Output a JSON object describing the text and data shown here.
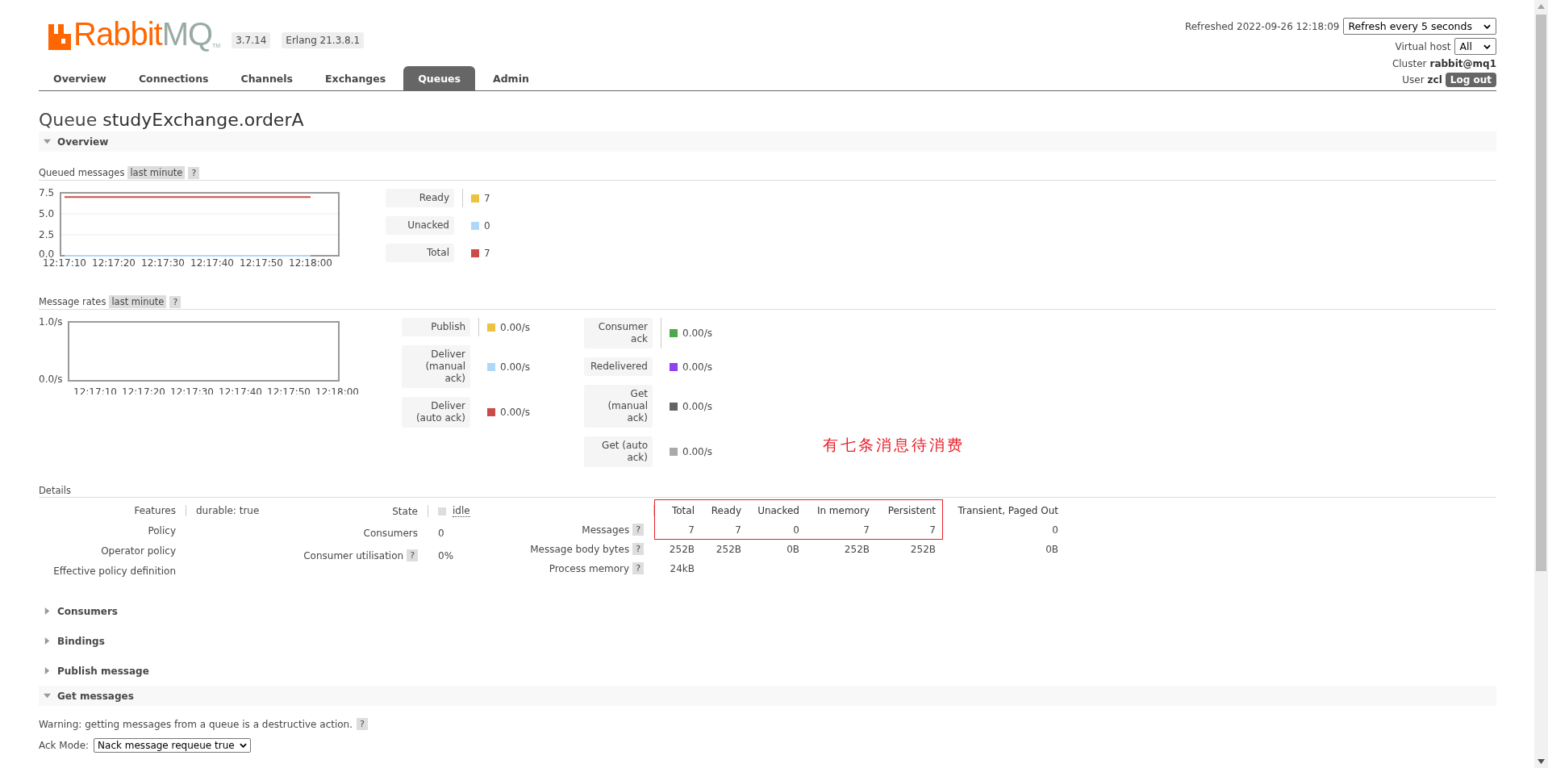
{
  "header": {
    "logo": {
      "word": "Rabbit",
      "suffix": "MQ",
      "mark": "TM"
    },
    "version": "3.7.14",
    "erlang": "Erlang 21.3.8.1",
    "refreshed": "Refreshed 2022-09-26 12:18:09",
    "refresh_select": "Refresh every 5 seconds",
    "vhost_label": "Virtual host",
    "vhost_select": "All",
    "cluster_label": "Cluster",
    "cluster": "rabbit@mq1",
    "user_label": "User",
    "user": "zcl",
    "logout": "Log out"
  },
  "tabs": [
    {
      "label": "Overview",
      "selected": false
    },
    {
      "label": "Connections",
      "selected": false
    },
    {
      "label": "Channels",
      "selected": false
    },
    {
      "label": "Exchanges",
      "selected": false
    },
    {
      "label": "Queues",
      "selected": true
    },
    {
      "label": "Admin",
      "selected": false
    }
  ],
  "title": {
    "prefix": "Queue",
    "name": "studyExchange.orderA"
  },
  "overview": {
    "heading": "Overview",
    "expanded": true,
    "queued": {
      "label": "Queued messages",
      "range": "last minute",
      "help": "?",
      "chart_data": {
        "type": "line",
        "categories": [
          "12:17:10",
          "12:17:20",
          "12:17:30",
          "12:17:40",
          "12:17:50",
          "12:18:00"
        ],
        "ylim": [
          0,
          7.5
        ],
        "yticks": [
          {
            "value": 0,
            "label": "0.0"
          },
          {
            "value": 2.5,
            "label": "2.5"
          },
          {
            "value": 5,
            "label": "5.0"
          },
          {
            "value": 7.5,
            "label": "7.5"
          }
        ],
        "series": [
          {
            "color": "#afd8f8",
            "values": [
              0,
              0,
              0,
              0,
              0,
              0
            ]
          },
          {
            "color": "#cb4b4b",
            "values": [
              7,
              7,
              7,
              7,
              7,
              7
            ]
          }
        ]
      },
      "legend": [
        {
          "label": "Ready",
          "color": "#edc240",
          "value": "7"
        },
        {
          "label": "Unacked",
          "color": "#afd8f8",
          "value": "0"
        },
        {
          "label": "Total",
          "color": "#cb4b4b",
          "value": "7"
        }
      ]
    },
    "rates": {
      "label": "Message rates",
      "range": "last minute",
      "help": "?",
      "chart_data": {
        "type": "line",
        "categories": [
          "12:17:10",
          "12:17:20",
          "12:17:30",
          "12:17:40",
          "12:17:50",
          "12:18:00"
        ],
        "ylim": [
          0,
          1
        ],
        "yticks": [
          {
            "value": 0,
            "label": "0.0/s"
          },
          {
            "value": 1,
            "label": "1.0/s"
          }
        ]
      },
      "legend_columns": [
        [
          {
            "label": "Publish",
            "color": "#edc240",
            "value": "0.00/s"
          },
          {
            "label": "Deliver (manual ack)",
            "color": "#afd8f8",
            "value": "0.00/s"
          },
          {
            "label": "Deliver (auto ack)",
            "color": "#cb4b4b",
            "value": "0.00/s"
          }
        ],
        [
          {
            "label": "Consumer ack",
            "color": "#4da74d",
            "value": "0.00/s"
          },
          {
            "label": "Redelivered",
            "color": "#9440ed",
            "value": "0.00/s"
          },
          {
            "label": "Get (manual ack)",
            "color": "#646464",
            "value": "0.00/s"
          },
          {
            "label": "Get (auto ack)",
            "color": "#aaaaaa",
            "value": "0.00/s"
          }
        ]
      ]
    }
  },
  "annotation": {
    "text": "有七条消息待消费"
  },
  "details": {
    "heading": "Details",
    "features": [
      {
        "label": "Features",
        "value": "durable: true"
      },
      {
        "label": "Policy"
      },
      {
        "label": "Operator policy"
      },
      {
        "label": "Effective policy definition"
      }
    ],
    "status": [
      {
        "label": "State",
        "value": "idle",
        "indicator": true
      },
      {
        "label": "Consumers",
        "value": "0"
      },
      {
        "label": "Consumer utilisation",
        "help": "?",
        "value": "0%"
      }
    ],
    "messages": {
      "columns": [
        "Total",
        "Ready",
        "Unacked",
        "In memory",
        "Persistent",
        "Transient, Paged Out"
      ],
      "rows": [
        {
          "label": "Messages",
          "help": "?",
          "cells": [
            "7",
            "7",
            "0",
            "7",
            "7",
            "0"
          ]
        },
        {
          "label": "Message body bytes",
          "help": "?",
          "cells": [
            "252B",
            "252B",
            "0B",
            "252B",
            "252B",
            "0B"
          ]
        },
        {
          "label": "Process memory",
          "help": "?",
          "cells": [
            "24kB"
          ]
        }
      ]
    }
  },
  "sections": [
    {
      "heading": "Consumers",
      "expanded": false
    },
    {
      "heading": "Bindings",
      "expanded": false
    },
    {
      "heading": "Publish message",
      "expanded": false
    },
    {
      "heading": "Get messages",
      "expanded": true
    }
  ],
  "get_messages": {
    "warning": "Warning: getting messages from a queue is a destructive action.",
    "help": "?",
    "ack_mode_label": "Ack Mode:",
    "ack_mode": "Nack message requeue true"
  }
}
